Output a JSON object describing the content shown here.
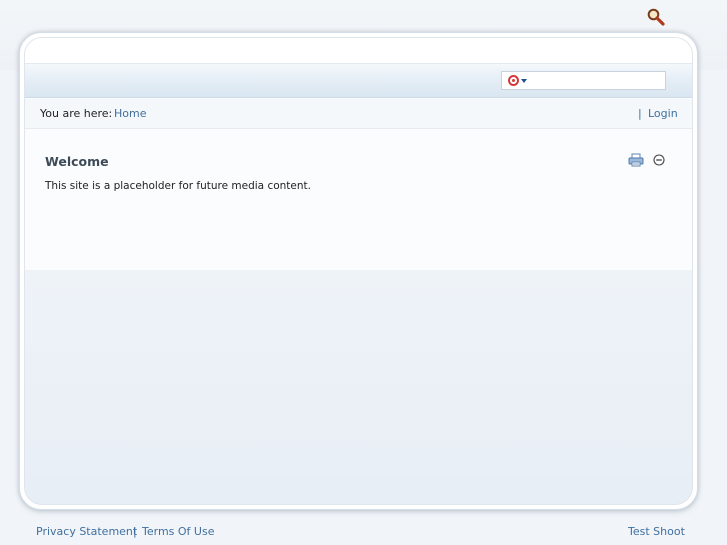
{
  "search": {
    "value": "",
    "placeholder": "",
    "engine_icon": "search-engine-icon",
    "go_icon": "magnifier-icon"
  },
  "breadcrumb": {
    "label": "You are here:",
    "home": "Home"
  },
  "auth": {
    "separator": "|",
    "login": "Login"
  },
  "module": {
    "title": "Welcome",
    "body": "This site is a placeholder for future media content.",
    "actions": [
      "print-icon",
      "minimize-icon"
    ]
  },
  "footer": {
    "privacy": "Privacy Statement",
    "separator": "|",
    "terms": "Terms Of Use",
    "copyright": "Test Shoot"
  },
  "colors": {
    "link": "#3f6f9f",
    "title": "#3d4a57",
    "page_background": "#f1f5f9"
  }
}
